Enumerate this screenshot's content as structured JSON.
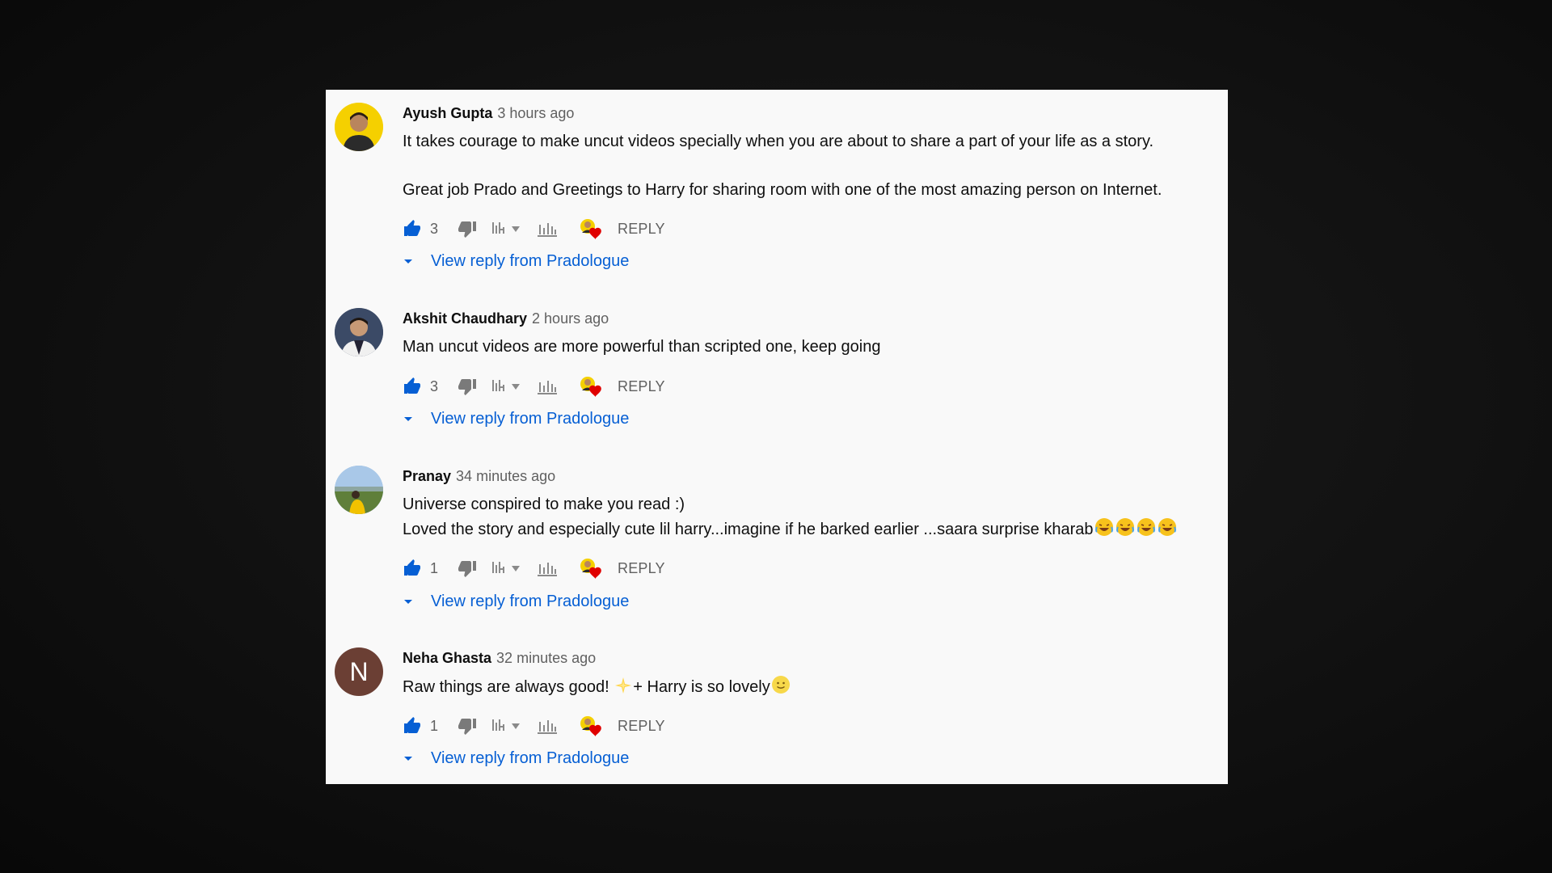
{
  "comments": [
    {
      "author": "Ayush Gupta",
      "time": "3 hours ago",
      "line1": "It takes courage to make uncut videos specially when you are about to share a part of your life as a story.",
      "line2": "Great job Prado and Greetings to Harry for sharing room with one of the most amazing person on Internet.",
      "likes": "3",
      "reply_label": "REPLY",
      "view_reply": "View reply from Pradologue",
      "avatar_color": "#f5d000"
    },
    {
      "author": "Akshit Chaudhary",
      "time": "2 hours ago",
      "line1": "Man uncut videos are more powerful than scripted one, keep going",
      "likes": "3",
      "reply_label": "REPLY",
      "view_reply": "View reply from Pradologue",
      "avatar_color": "#3b4a66"
    },
    {
      "author": "Pranay",
      "time": "34 minutes ago",
      "line1": "Universe conspired to make you read :)",
      "line2": "Loved the story and especially cute lil harry...imagine if he barked earlier ...saara surprise kharab",
      "likes": "1",
      "reply_label": "REPLY",
      "view_reply": "View reply from Pradologue",
      "avatar_color": "#8fb3d9"
    },
    {
      "author": "Neha Ghasta",
      "time": "32 minutes ago",
      "line1_a": "Raw things are always good! ",
      "line1_b": "+ Harry is so lovely",
      "initial": "N",
      "likes": "1",
      "reply_label": "REPLY",
      "view_reply": "View reply from Pradologue",
      "avatar_color": "#6b3f34"
    }
  ],
  "colors": {
    "like_active": "#065fd4",
    "link": "#065fd4",
    "icon_gray": "#7a7a7a",
    "heart": "#e00000"
  }
}
